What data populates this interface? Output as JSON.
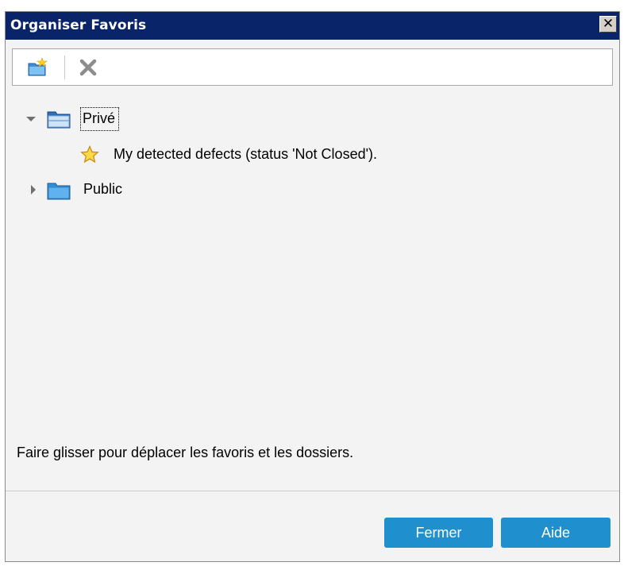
{
  "dialog": {
    "title": "Organiser Favoris",
    "close_label": "✕"
  },
  "toolbar": {
    "items": [
      {
        "name": "new-folder",
        "icon": "new-folder-icon"
      },
      {
        "name": "delete",
        "icon": "delete-x-icon"
      }
    ]
  },
  "tree": {
    "nodes": [
      {
        "label": "Privé",
        "expanded": true,
        "icon": "folder-icon",
        "children": [
          {
            "label": "My detected defects (status 'Not Closed').",
            "icon": "star-icon"
          }
        ]
      },
      {
        "label": "Public",
        "expanded": false,
        "icon": "folder-icon"
      }
    ]
  },
  "hint": "Faire glisser pour déplacer les favoris et les dossiers.",
  "buttons": {
    "close": "Fermer",
    "help": "Aide"
  },
  "colors": {
    "titlebar": "#0a246a",
    "button": "#1f8fce",
    "dialog_bg": "#f3f3f3"
  }
}
